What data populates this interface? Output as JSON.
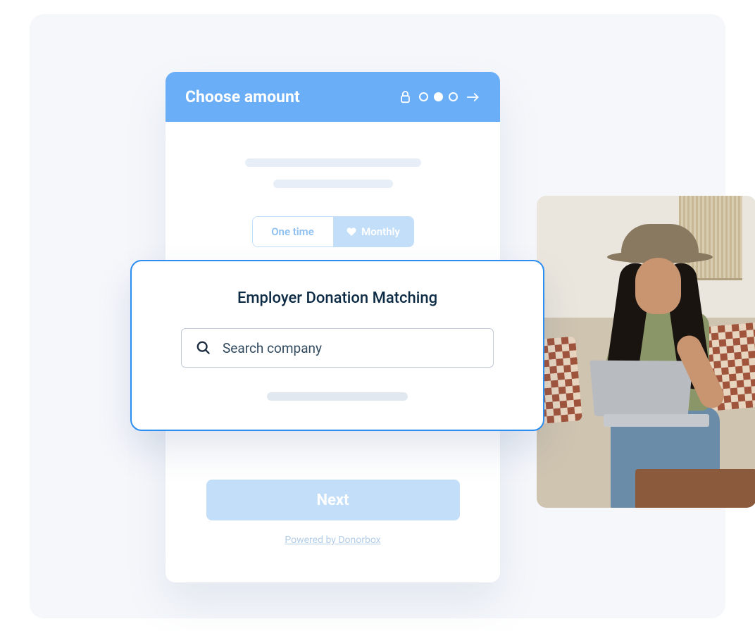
{
  "header": {
    "title": "Choose amount"
  },
  "frequency": {
    "onetime_label": "One time",
    "monthly_label": "Monthly"
  },
  "matching": {
    "title": "Employer Donation Matching",
    "search_placeholder": "Search company"
  },
  "next_button_label": "Next",
  "powered_by": "Powered by Donorbox"
}
